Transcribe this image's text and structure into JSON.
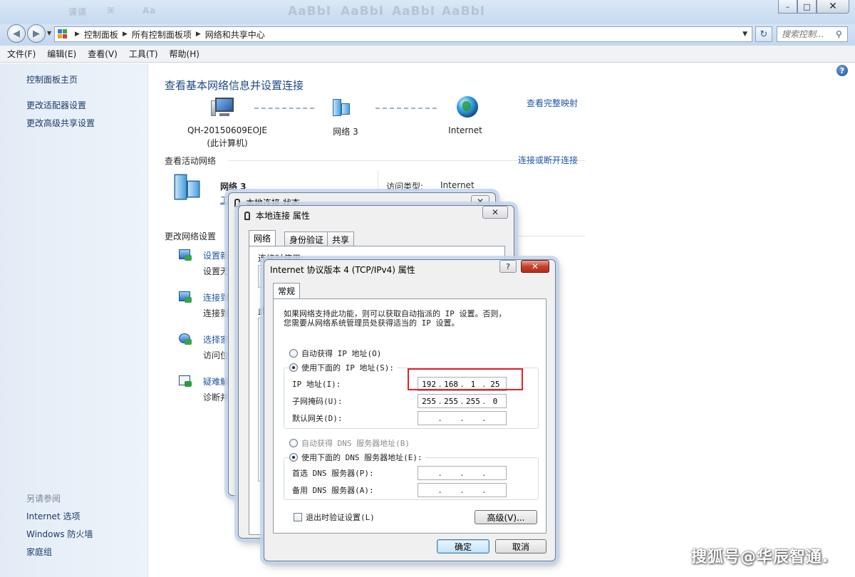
{
  "window": {
    "ghost_text": [
      "课课",
      "⌘",
      "Aa"
    ],
    "ghost_big": [
      "AaBbI",
      "AaBbI",
      "AaBbI",
      "AaBbI"
    ],
    "btn_min": "–",
    "btn_max": "□",
    "btn_close": "✕"
  },
  "address": {
    "crumbs": [
      "控制面板",
      "所有控制面板项",
      "网络和共享中心"
    ],
    "search_placeholder": "搜索控制...",
    "refresh_glyph": "↻"
  },
  "menu": [
    "文件(F)",
    "编辑(E)",
    "查看(V)",
    "工具(T)",
    "帮助(H)"
  ],
  "left": {
    "links": [
      "控制面板主页",
      "更改适配器设置",
      "更改高级共享设置"
    ],
    "see_also": "另请参阅",
    "see_also_links": [
      "Internet 选项",
      "Windows 防火墙",
      "家庭组"
    ]
  },
  "main": {
    "title": "查看基本网络信息并设置连接",
    "full_map": "查看完整映射",
    "pc_name": "QH-20150609EOJE",
    "pc_sub": "(此计算机)",
    "network_name": "网络 3",
    "internet": "Internet",
    "active_networks": "查看活动网络",
    "connect_disconnect": "连接或断开连接",
    "active_net_name": "网络 3",
    "access_type_label": "访问类型:",
    "access_type_value": "Internet",
    "partial_link": "工",
    "change_settings": "更改网络设置",
    "tasks": [
      {
        "title": "设置新",
        "desc": "设置无"
      },
      {
        "title": "连接到",
        "desc": "连接到"
      },
      {
        "title": "选择家",
        "desc": "访问位"
      },
      {
        "title": "疑难解",
        "desc": "诊断并"
      }
    ]
  },
  "status_dialog": {
    "title": "本地连接 状态"
  },
  "props_dialog": {
    "title": "本地连接 属性",
    "tabs": [
      "网络",
      "身份验证",
      "共享"
    ],
    "connect_using": "连接时使用:",
    "partial_label": "此"
  },
  "ipv4_dialog": {
    "title": "Internet 协议版本 4 (TCP/IPv4) 属性",
    "help_glyph": "?",
    "tab": "常规",
    "intro_line1": "如果网络支持此功能，则可以获取自动指派的 IP 设置。否则，",
    "intro_line2": "您需要从网络系统管理员处获得适当的 IP 设置。",
    "auto_ip": "自动获得 IP 地址(O)",
    "manual_ip": "使用下面的 IP 地址(S):",
    "ip_label": "IP 地址(I):",
    "ip_value": [
      "192",
      "168",
      "1",
      "25"
    ],
    "mask_label": "子网掩码(U):",
    "mask_value": [
      "255",
      "255",
      "255",
      "0"
    ],
    "gateway_label": "默认网关(D):",
    "auto_dns": "自动获得 DNS 服务器地址(B)",
    "manual_dns": "使用下面的 DNS 服务器地址(E):",
    "pref_dns_label": "首选 DNS 服务器(P):",
    "alt_dns_label": "备用 DNS 服务器(A):",
    "validate_on_exit": "退出时验证设置(L)",
    "advanced": "高级(V)...",
    "ok": "确定",
    "cancel": "取消",
    "dot": "."
  },
  "watermark": "搜狐号@华辰智通."
}
